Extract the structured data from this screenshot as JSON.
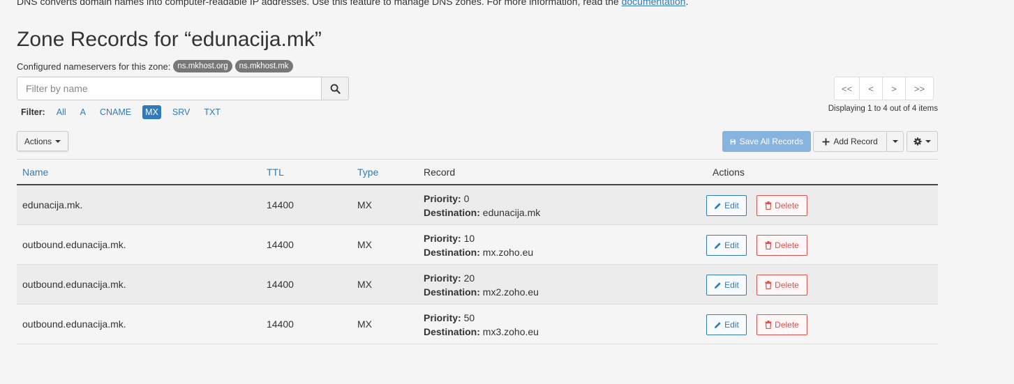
{
  "intro": {
    "text": "DNS converts domain names into computer-readable IP addresses. Use this feature to manage DNS zones. For more information, read the ",
    "link": "documentation",
    "suffix": "."
  },
  "title": "Zone Records for “edunacija.mk”",
  "nameservers": {
    "label": "Configured nameservers for this zone:",
    "items": [
      "ns.mkhost.org",
      "ns.mkhost.mk"
    ]
  },
  "search": {
    "placeholder": "Filter by name",
    "value": ""
  },
  "filter": {
    "label": "Filter:",
    "options": [
      "All",
      "A",
      "CNAME",
      "MX",
      "SRV",
      "TXT"
    ],
    "active": "MX"
  },
  "pagination": {
    "first": "<<",
    "prev": "<",
    "next": ">",
    "last": ">>",
    "summary": "Displaying 1 to 4 out of 4 items"
  },
  "toolbar": {
    "actions_label": "Actions",
    "save_all_label": "Save All Records",
    "add_record_label": "Add Record"
  },
  "table": {
    "columns": {
      "name": "Name",
      "ttl": "TTL",
      "type": "Type",
      "record": "Record",
      "actions": "Actions"
    },
    "priority_label": "Priority:",
    "destination_label": "Destination:",
    "edit_label": "Edit",
    "delete_label": "Delete",
    "rows": [
      {
        "name": "edunacija.mk.",
        "ttl": "14400",
        "type": "MX",
        "priority": "0",
        "destination": "edunacija.mk"
      },
      {
        "name": "outbound.edunacija.mk.",
        "ttl": "14400",
        "type": "MX",
        "priority": "10",
        "destination": "mx.zoho.eu"
      },
      {
        "name": "outbound.edunacija.mk.",
        "ttl": "14400",
        "type": "MX",
        "priority": "20",
        "destination": "mx2.zoho.eu"
      },
      {
        "name": "outbound.edunacija.mk.",
        "ttl": "14400",
        "type": "MX",
        "priority": "50",
        "destination": "mx3.zoho.eu"
      }
    ]
  },
  "colors": {
    "link": "#337ab7",
    "danger": "#d9534f",
    "save_disabled": "#88b3de",
    "badge": "#777777"
  }
}
